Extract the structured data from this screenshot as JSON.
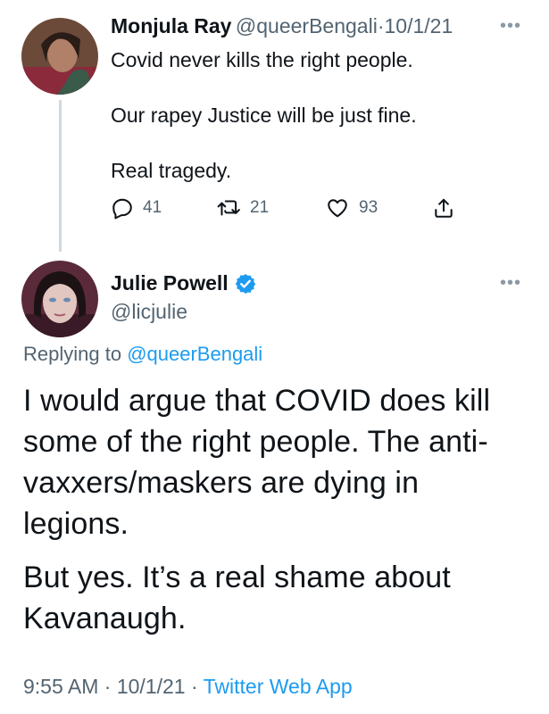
{
  "parent_tweet": {
    "author_name": "Monjula Ray",
    "author_handle": "@queerBengali",
    "separator": "·",
    "date": "10/1/21",
    "more_label": "•••",
    "lines": [
      "Covid never kills the right people.",
      "Our rapey Justice will be just fine.",
      "Real tragedy."
    ],
    "actions": {
      "reply_count": "41",
      "retweet_count": "21",
      "like_count": "93"
    }
  },
  "main_tweet": {
    "author_name": "Julie Powell",
    "verified": true,
    "author_handle": "@licjulie",
    "more_label": "•••",
    "replying_prefix": "Replying to",
    "replying_handle": "@queerBengali",
    "paragraph1_lines": [
      "I would argue that COVID does kill",
      "some of the right people. The anti-",
      "vaxxers/maskers are dying in",
      "legions."
    ],
    "paragraph2_lines": [
      "But yes. It’s a real shame about",
      "Kavanaugh."
    ],
    "time": "9:55 AM",
    "separator": "·",
    "date": "10/1/21",
    "source": "Twitter Web App"
  },
  "colors": {
    "accent": "#1d9bf0",
    "secondary_text": "#536471",
    "verified_badge": "#1d9bf0"
  }
}
